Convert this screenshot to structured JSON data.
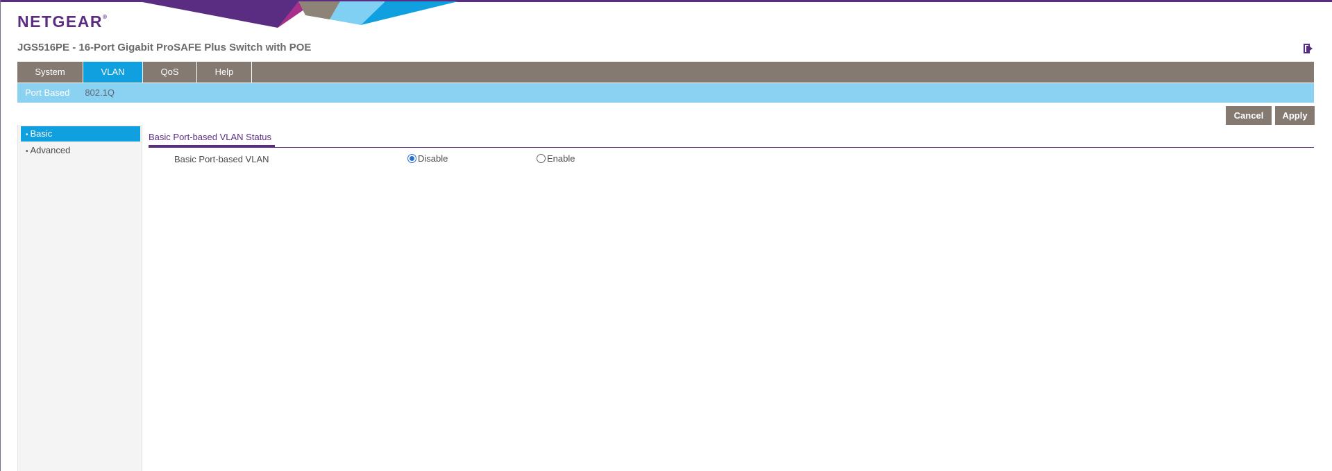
{
  "brand": {
    "logo_text": "NETGEAR",
    "logo_mark": "®",
    "colors": {
      "purple": "#5a2d82",
      "nav_gray": "#857a72",
      "active_blue": "#10a0e0",
      "subnav_blue": "#8bd1f2"
    }
  },
  "header": {
    "product_title": "JGS516PE - 16-Port Gigabit ProSAFE Plus Switch with POE",
    "logout_icon": "logout-icon"
  },
  "main_nav": {
    "tabs": [
      {
        "label": "System",
        "active": false
      },
      {
        "label": "VLAN",
        "active": true
      },
      {
        "label": "QoS",
        "active": false
      },
      {
        "label": "Help",
        "active": false
      }
    ]
  },
  "sub_nav": {
    "tabs": [
      {
        "label": "Port Based",
        "active": true
      },
      {
        "label": "802.1Q",
        "active": false
      }
    ]
  },
  "actions": {
    "cancel_label": "Cancel",
    "apply_label": "Apply"
  },
  "side_menu": {
    "items": [
      {
        "bullet": "•",
        "label": "Basic",
        "active": true
      },
      {
        "bullet": "•",
        "label": "Advanced",
        "active": false
      }
    ]
  },
  "content": {
    "section_title": "Basic Port-based VLAN Status",
    "field_label": "Basic Port-based VLAN",
    "options": [
      {
        "label": "Disable",
        "checked": true
      },
      {
        "label": "Enable",
        "checked": false
      }
    ]
  }
}
